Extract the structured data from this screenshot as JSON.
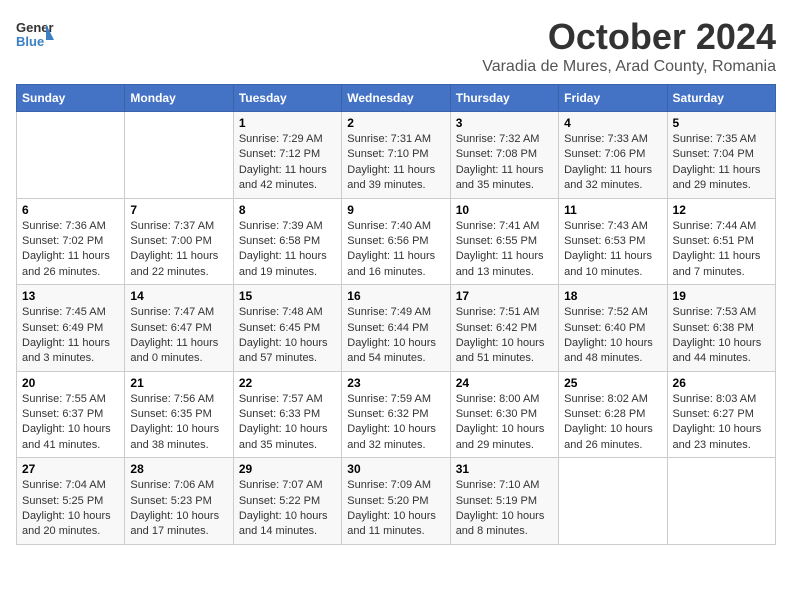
{
  "header": {
    "logo_general": "General",
    "logo_blue": "Blue",
    "month_title": "October 2024",
    "subtitle": "Varadia de Mures, Arad County, Romania"
  },
  "days_of_week": [
    "Sunday",
    "Monday",
    "Tuesday",
    "Wednesday",
    "Thursday",
    "Friday",
    "Saturday"
  ],
  "weeks": [
    [
      {
        "day": "",
        "info": ""
      },
      {
        "day": "",
        "info": ""
      },
      {
        "day": "1",
        "info": "Sunrise: 7:29 AM\nSunset: 7:12 PM\nDaylight: 11 hours and 42 minutes."
      },
      {
        "day": "2",
        "info": "Sunrise: 7:31 AM\nSunset: 7:10 PM\nDaylight: 11 hours and 39 minutes."
      },
      {
        "day": "3",
        "info": "Sunrise: 7:32 AM\nSunset: 7:08 PM\nDaylight: 11 hours and 35 minutes."
      },
      {
        "day": "4",
        "info": "Sunrise: 7:33 AM\nSunset: 7:06 PM\nDaylight: 11 hours and 32 minutes."
      },
      {
        "day": "5",
        "info": "Sunrise: 7:35 AM\nSunset: 7:04 PM\nDaylight: 11 hours and 29 minutes."
      }
    ],
    [
      {
        "day": "6",
        "info": "Sunrise: 7:36 AM\nSunset: 7:02 PM\nDaylight: 11 hours and 26 minutes."
      },
      {
        "day": "7",
        "info": "Sunrise: 7:37 AM\nSunset: 7:00 PM\nDaylight: 11 hours and 22 minutes."
      },
      {
        "day": "8",
        "info": "Sunrise: 7:39 AM\nSunset: 6:58 PM\nDaylight: 11 hours and 19 minutes."
      },
      {
        "day": "9",
        "info": "Sunrise: 7:40 AM\nSunset: 6:56 PM\nDaylight: 11 hours and 16 minutes."
      },
      {
        "day": "10",
        "info": "Sunrise: 7:41 AM\nSunset: 6:55 PM\nDaylight: 11 hours and 13 minutes."
      },
      {
        "day": "11",
        "info": "Sunrise: 7:43 AM\nSunset: 6:53 PM\nDaylight: 11 hours and 10 minutes."
      },
      {
        "day": "12",
        "info": "Sunrise: 7:44 AM\nSunset: 6:51 PM\nDaylight: 11 hours and 7 minutes."
      }
    ],
    [
      {
        "day": "13",
        "info": "Sunrise: 7:45 AM\nSunset: 6:49 PM\nDaylight: 11 hours and 3 minutes."
      },
      {
        "day": "14",
        "info": "Sunrise: 7:47 AM\nSunset: 6:47 PM\nDaylight: 11 hours and 0 minutes."
      },
      {
        "day": "15",
        "info": "Sunrise: 7:48 AM\nSunset: 6:45 PM\nDaylight: 10 hours and 57 minutes."
      },
      {
        "day": "16",
        "info": "Sunrise: 7:49 AM\nSunset: 6:44 PM\nDaylight: 10 hours and 54 minutes."
      },
      {
        "day": "17",
        "info": "Sunrise: 7:51 AM\nSunset: 6:42 PM\nDaylight: 10 hours and 51 minutes."
      },
      {
        "day": "18",
        "info": "Sunrise: 7:52 AM\nSunset: 6:40 PM\nDaylight: 10 hours and 48 minutes."
      },
      {
        "day": "19",
        "info": "Sunrise: 7:53 AM\nSunset: 6:38 PM\nDaylight: 10 hours and 44 minutes."
      }
    ],
    [
      {
        "day": "20",
        "info": "Sunrise: 7:55 AM\nSunset: 6:37 PM\nDaylight: 10 hours and 41 minutes."
      },
      {
        "day": "21",
        "info": "Sunrise: 7:56 AM\nSunset: 6:35 PM\nDaylight: 10 hours and 38 minutes."
      },
      {
        "day": "22",
        "info": "Sunrise: 7:57 AM\nSunset: 6:33 PM\nDaylight: 10 hours and 35 minutes."
      },
      {
        "day": "23",
        "info": "Sunrise: 7:59 AM\nSunset: 6:32 PM\nDaylight: 10 hours and 32 minutes."
      },
      {
        "day": "24",
        "info": "Sunrise: 8:00 AM\nSunset: 6:30 PM\nDaylight: 10 hours and 29 minutes."
      },
      {
        "day": "25",
        "info": "Sunrise: 8:02 AM\nSunset: 6:28 PM\nDaylight: 10 hours and 26 minutes."
      },
      {
        "day": "26",
        "info": "Sunrise: 8:03 AM\nSunset: 6:27 PM\nDaylight: 10 hours and 23 minutes."
      }
    ],
    [
      {
        "day": "27",
        "info": "Sunrise: 7:04 AM\nSunset: 5:25 PM\nDaylight: 10 hours and 20 minutes."
      },
      {
        "day": "28",
        "info": "Sunrise: 7:06 AM\nSunset: 5:23 PM\nDaylight: 10 hours and 17 minutes."
      },
      {
        "day": "29",
        "info": "Sunrise: 7:07 AM\nSunset: 5:22 PM\nDaylight: 10 hours and 14 minutes."
      },
      {
        "day": "30",
        "info": "Sunrise: 7:09 AM\nSunset: 5:20 PM\nDaylight: 10 hours and 11 minutes."
      },
      {
        "day": "31",
        "info": "Sunrise: 7:10 AM\nSunset: 5:19 PM\nDaylight: 10 hours and 8 minutes."
      },
      {
        "day": "",
        "info": ""
      },
      {
        "day": "",
        "info": ""
      }
    ]
  ]
}
